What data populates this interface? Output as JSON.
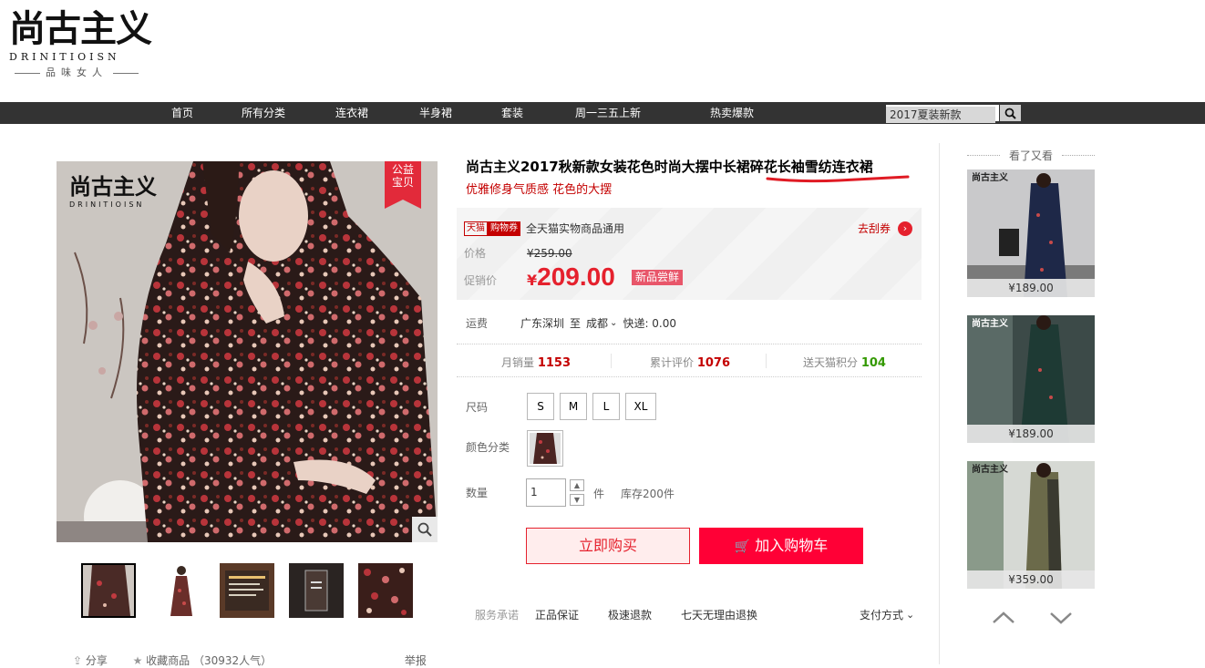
{
  "logo": {
    "name_cn": "尚古主义",
    "name_en": "DRINITIOISN",
    "tagline": "品味女人"
  },
  "nav": {
    "items": [
      "首页",
      "所有分类",
      "连衣裙",
      "半身裙",
      "套装",
      "周一三五上新",
      "热卖爆款"
    ],
    "search_value": "2017夏装新款"
  },
  "gallery": {
    "image_brand_cn": "尚古主义",
    "image_brand_en": "DRINITIOISN",
    "badge": "公益宝贝",
    "badge_line1": "公益",
    "badge_line2": "宝贝"
  },
  "share": {
    "share_label": "分享",
    "fav_label": "收藏商品",
    "fav_count": "（30932人气）",
    "report_label": "举报"
  },
  "product": {
    "title_plain": "尚古主义2017秋新款女装花色时尚大摆中长裙",
    "title_underlined": "碎花长袖雪纺连衣裙",
    "subtitle": "优雅修身气质感 花色的大摆"
  },
  "coupon": {
    "tag_tmall": "天猫",
    "tag_coupon": "购物券",
    "text": "全天猫实物商品通用",
    "link": "去刮券"
  },
  "price": {
    "label": "价格",
    "original": "¥259.00",
    "promo_label": "促销价",
    "currency": "¥",
    "promo_value": "209.00",
    "promo_tag": "新品尝鲜"
  },
  "shipping": {
    "label": "运费",
    "from": "广东深圳",
    "to_prefix": "至",
    "to": "成都",
    "method": "快递: 0.00"
  },
  "stats": {
    "sales_label": "月销量",
    "sales_value": "1153",
    "reviews_label": "累计评价",
    "reviews_value": "1076",
    "points_label": "送天猫积分",
    "points_value": "104"
  },
  "options": {
    "size_label": "尺码",
    "sizes": [
      "S",
      "M",
      "L",
      "XL"
    ],
    "color_label": "颜色分类",
    "qty_label": "数量",
    "qty_value": "1",
    "qty_unit": "件",
    "stock": "库存200件"
  },
  "actions": {
    "buy_now": "立即购买",
    "add_cart": "加入购物车"
  },
  "service": {
    "label": "服务承诺",
    "items": [
      "正品保证",
      "极速退款",
      "七天无理由退换"
    ],
    "payment": "支付方式"
  },
  "related": {
    "title": "看了又看",
    "items": [
      {
        "price": "¥189.00"
      },
      {
        "price": "¥189.00"
      },
      {
        "price": "¥359.00"
      }
    ]
  },
  "colors": {
    "accent": "#ff0036",
    "price_red": "#e5212d",
    "nav_bg": "#333333",
    "points_green": "#339900"
  }
}
